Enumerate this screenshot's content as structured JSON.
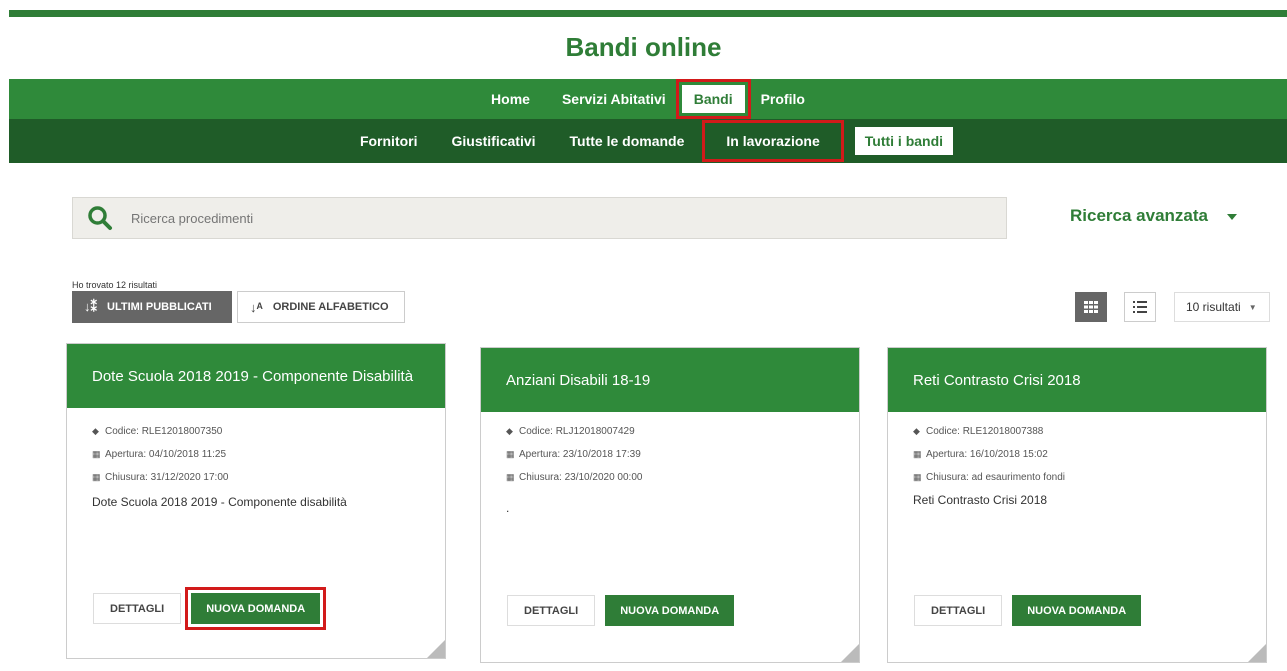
{
  "header": {
    "title": "Bandi online"
  },
  "nav_primary": {
    "items": [
      "Home",
      "Servizi Abitativi",
      "Bandi",
      "Profilo"
    ],
    "active": "Bandi"
  },
  "nav_secondary": {
    "items": [
      "Fornitori",
      "Giustificativi",
      "Tutte le domande",
      "In lavorazione",
      "Tutti i bandi"
    ],
    "active": "Tutti i bandi",
    "highlighted": "In lavorazione"
  },
  "search": {
    "placeholder": "Ricerca procedimenti",
    "advanced_label": "Ricerca avanzata"
  },
  "results": {
    "found_text": "Ho trovato 12 risultati",
    "sort_latest": "ULTIMI PUBBLICATI",
    "sort_alpha": "ORDINE ALFABETICO",
    "per_page": "10 risultati"
  },
  "cards": [
    {
      "title": "Dote Scuola 2018 2019 - Componente Disabilità",
      "codice_label": "Codice:",
      "codice": "RLE12018007350",
      "apertura_label": "Apertura:",
      "apertura": "04/10/2018 11:25",
      "chiusura_label": "Chiusura:",
      "chiusura": "31/12/2020 17:00",
      "description": "Dote Scuola 2018 2019 - Componente disabilità",
      "details_label": "DETTAGLI",
      "new_label": "NUOVA DOMANDA"
    },
    {
      "title": "Anziani Disabili 18-19",
      "codice_label": "Codice:",
      "codice": "RLJ12018007429",
      "apertura_label": "Apertura:",
      "apertura": "23/10/2018 17:39",
      "chiusura_label": "Chiusura:",
      "chiusura": "23/10/2020 00:00",
      "description": ".",
      "details_label": "DETTAGLI",
      "new_label": "NUOVA DOMANDA"
    },
    {
      "title": "Reti Contrasto Crisi 2018",
      "codice_label": "Codice:",
      "codice": "RLE12018007388",
      "apertura_label": "Apertura:",
      "apertura": "16/10/2018 15:02",
      "chiusura_label": "Chiusura:",
      "chiusura": "ad esaurimento fondi",
      "description": "Reti Contrasto Crisi 2018",
      "details_label": "DETTAGLI",
      "new_label": "NUOVA DOMANDA"
    }
  ],
  "colors": {
    "primary_green": "#2f8a3a",
    "dark_green": "#1f5c28",
    "highlight_red": "#d21a1a"
  }
}
